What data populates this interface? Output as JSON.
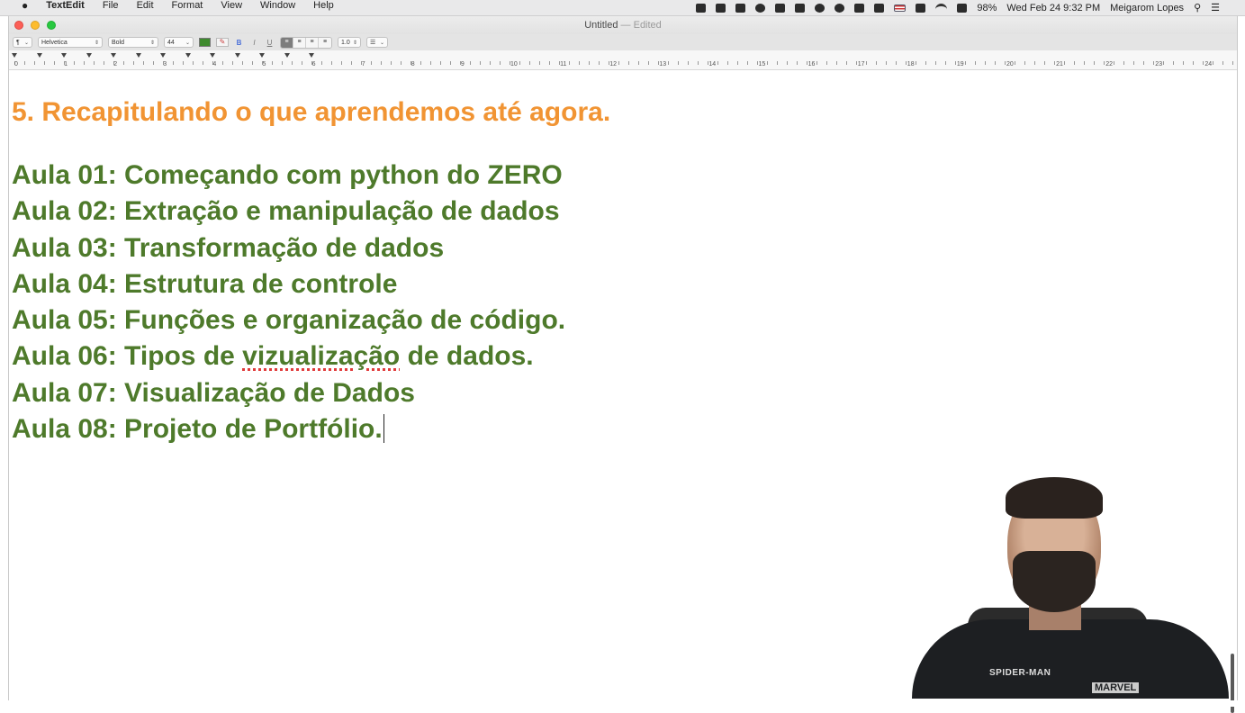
{
  "menubar": {
    "apple": "",
    "app_name": "TextEdit",
    "menus": [
      "File",
      "Edit",
      "Format",
      "View",
      "Window",
      "Help"
    ],
    "battery": "98%",
    "datetime": "Wed Feb 24  9:32 PM",
    "user": "Meigarom Lopes"
  },
  "window": {
    "title": "Untitled",
    "title_suffix": "— Edited"
  },
  "toolbar": {
    "paragraph_style": "¶",
    "font_family": "Helvetica",
    "font_style": "Bold",
    "font_size": "44",
    "bold_label": "B",
    "italic_label": "I",
    "underline_label": "U",
    "line_spacing": "1.0",
    "list_style": "☰",
    "text_color": "#3f8a2e"
  },
  "ruler": {
    "numbers": [
      "0",
      "1",
      "2",
      "3",
      "4",
      "5",
      "6",
      "7",
      "8",
      "9",
      "10",
      "11",
      "12",
      "13",
      "14",
      "15",
      "16",
      "17",
      "18",
      "19",
      "20",
      "21",
      "22",
      "23",
      "24"
    ]
  },
  "document": {
    "heading": "5. Recapitulando o que aprendemos até agora.",
    "heading_color": "#f19433",
    "lines_color": "#4e7a2b",
    "lines": [
      "Aula 01: Começando com python do ZERO",
      "Aula 02: Extração e manipulação de dados",
      "Aula 03: Transformação de dados",
      "Aula 04: Estrutura de controle",
      "Aula 05: Funções e organização de código.",
      "Aula 06: Tipos de ",
      "Aula 07: Visualização de Dados",
      "Aula 08: Projeto de Portfólio."
    ],
    "line6_misspelled": "vizualização",
    "line6_tail": " de dados."
  },
  "webcam": {
    "shirt_text": "SPIDER-MAN",
    "shirt_brand": "MARVEL"
  }
}
